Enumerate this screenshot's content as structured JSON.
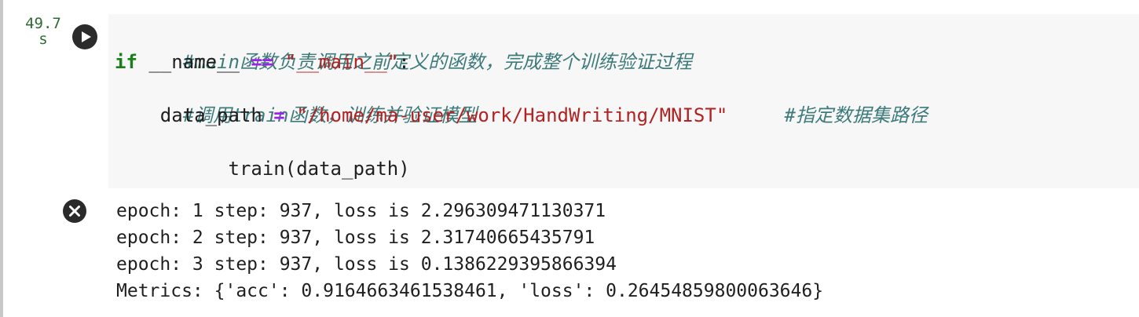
{
  "cell": {
    "execution_time": "49.7\ns",
    "code": {
      "comment_main": "#main函数负责调用之前定义的函数，完成整个训练验证过程",
      "if_keyword": "if",
      "name_var": " __name__ ",
      "eq_op": "==",
      "main_string": " \"__main__\"",
      "colon": ":",
      "comment_train": "#调用train函数，训练并验证模型",
      "data_path_var": "    data_path ",
      "assign_op": "=",
      "path_string": " \"/home/ma-user/work/HandWriting/MNIST\"",
      "spacer": "     ",
      "comment_path": "#指定数据集路径",
      "train_call": "    train(data_path)"
    },
    "output": {
      "lines": [
        "epoch: 1 step: 937, loss is 2.296309471130371",
        "epoch: 2 step: 937, loss is 2.31740665435791",
        "epoch: 3 step: 937, loss is 0.1386229395866394",
        "Metrics: {'acc': 0.9164663461538461, 'loss': 0.26454859800063646}"
      ]
    }
  }
}
